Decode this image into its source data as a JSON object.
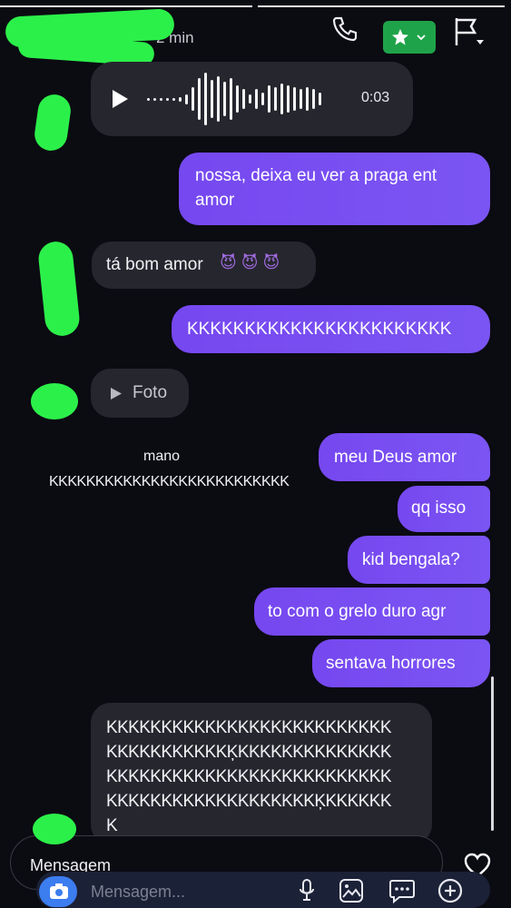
{
  "header": {
    "status": "2 min",
    "colors": {
      "accent_green": "#1fa34a",
      "scribble": "#2cf04a"
    },
    "icons": [
      "phone-icon",
      "star-badge-icon",
      "flag-icon"
    ]
  },
  "messages": {
    "audio_duration": "0:03",
    "out_1": "nossa, deixa eu ver a praga ent",
    "out_1b": "amor",
    "in_1": "tá bom amor",
    "in_1_emoji": "😈 😈 😈",
    "out_2": "KKKKKKKKKKKKKKKKKKKKKKK",
    "in_photo": "Foto",
    "reply_preview_1": "mano",
    "reply_preview_2": "KKKKKKKKKKKKKKKKKKKKKKKKKK",
    "out_3": "meu Deus amor",
    "out_4": "qq isso",
    "out_5": "kid bengala?",
    "out_6": "to com o grelo duro agr",
    "out_7": "sentava horrores",
    "in_long_1": "KKKKKKKKKKKKKKKKKKKKKKKKKK",
    "in_long_2": "KKKKKKKKKKKĶKKKKKKKKKKKKKK",
    "in_long_3": "KKKKKKKKKKKKKKKKKKKKKKKKKK",
    "in_long_4": "KKKKKKKKKKKKKKKKKKKĶKKKKKK",
    "in_long_5": "K"
  },
  "composer": {
    "label": "Mensagem",
    "placeholder": "Mensagem..."
  }
}
